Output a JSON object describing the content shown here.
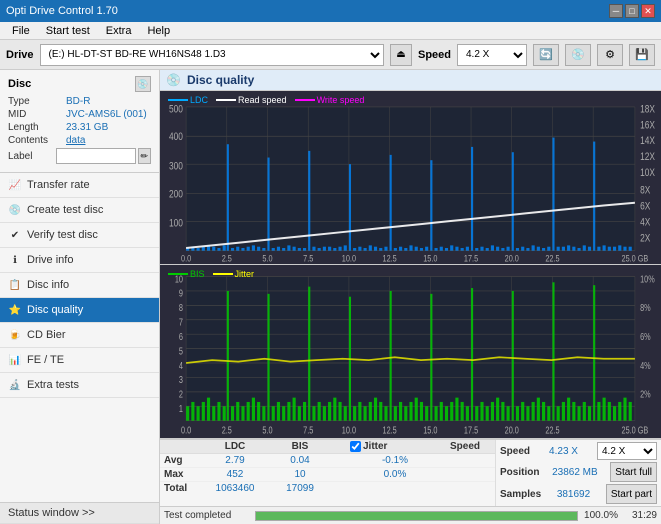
{
  "titlebar": {
    "title": "Opti Drive Control 1.70",
    "minimize": "─",
    "maximize": "□",
    "close": "✕"
  },
  "menubar": {
    "items": [
      "File",
      "Start test",
      "Extra",
      "Help"
    ]
  },
  "drivebar": {
    "drive_label": "Drive",
    "drive_value": "(E:)  HL-DT-ST BD-RE  WH16NS48 1.D3",
    "speed_label": "Speed",
    "speed_value": "4.2 X"
  },
  "disc": {
    "title": "Disc",
    "type_label": "Type",
    "type_value": "BD-R",
    "mid_label": "MID",
    "mid_value": "JVC-AMS6L (001)",
    "length_label": "Length",
    "length_value": "23.31 GB",
    "contents_label": "Contents",
    "contents_value": "data",
    "label_label": "Label",
    "label_placeholder": ""
  },
  "sidebar": {
    "items": [
      {
        "id": "transfer-rate",
        "label": "Transfer rate",
        "icon": "📈"
      },
      {
        "id": "create-test-disc",
        "label": "Create test disc",
        "icon": "💿"
      },
      {
        "id": "verify-test-disc",
        "label": "Verify test disc",
        "icon": "✔"
      },
      {
        "id": "drive-info",
        "label": "Drive info",
        "icon": "ℹ"
      },
      {
        "id": "disc-info",
        "label": "Disc info",
        "icon": "📋"
      },
      {
        "id": "disc-quality",
        "label": "Disc quality",
        "icon": "⭐",
        "active": true
      },
      {
        "id": "cd-bier",
        "label": "CD Bier",
        "icon": "🍺"
      },
      {
        "id": "fe-te",
        "label": "FE / TE",
        "icon": "📊"
      },
      {
        "id": "extra-tests",
        "label": "Extra tests",
        "icon": "🔬"
      }
    ],
    "status_window": "Status window >>"
  },
  "content": {
    "header_title": "Disc quality",
    "chart1": {
      "legend": [
        {
          "label": "LDC",
          "color": "#00aaff"
        },
        {
          "label": "Read speed",
          "color": "#ffffff"
        },
        {
          "label": "Write speed",
          "color": "#ff00ff"
        }
      ],
      "y_max": 500,
      "y_labels": [
        "500",
        "400",
        "300",
        "200",
        "100",
        "0"
      ],
      "y_right_labels": [
        "18X",
        "16X",
        "14X",
        "12X",
        "10X",
        "8X",
        "6X",
        "4X",
        "2X"
      ],
      "x_labels": [
        "0.0",
        "2.5",
        "5.0",
        "7.5",
        "10.0",
        "12.5",
        "15.0",
        "17.5",
        "20.0",
        "22.5",
        "25.0 GB"
      ]
    },
    "chart2": {
      "legend": [
        {
          "label": "BIS",
          "color": "#00cc00"
        },
        {
          "label": "Jitter",
          "color": "#ffff00"
        }
      ],
      "y_max": 10,
      "y_labels": [
        "10",
        "9",
        "8",
        "7",
        "6",
        "5",
        "4",
        "3",
        "2",
        "1"
      ],
      "y_right_labels": [
        "10%",
        "8%",
        "6%",
        "4%",
        "2%"
      ],
      "x_labels": [
        "0.0",
        "2.5",
        "5.0",
        "7.5",
        "10.0",
        "12.5",
        "15.0",
        "17.5",
        "20.0",
        "22.5",
        "25.0 GB"
      ]
    },
    "stats": {
      "headers": [
        "",
        "LDC",
        "BIS",
        "",
        "Jitter",
        "Speed",
        ""
      ],
      "avg_label": "Avg",
      "avg_ldc": "2.79",
      "avg_bis": "0.04",
      "avg_jitter": "-0.1%",
      "max_label": "Max",
      "max_ldc": "452",
      "max_bis": "10",
      "max_jitter": "0.0%",
      "total_label": "Total",
      "total_ldc": "1063460",
      "total_bis": "17099",
      "jitter_checked": true,
      "jitter_label": "Jitter",
      "speed_label": "Speed",
      "speed_value": "4.23 X",
      "speed_select": "4.2 X",
      "position_label": "Position",
      "position_value": "23862 MB",
      "samples_label": "Samples",
      "samples_value": "381692",
      "start_full_label": "Start full",
      "start_part_label": "Start part"
    },
    "progress": {
      "percent": 100,
      "time": "31:29",
      "status": "Test completed"
    }
  }
}
